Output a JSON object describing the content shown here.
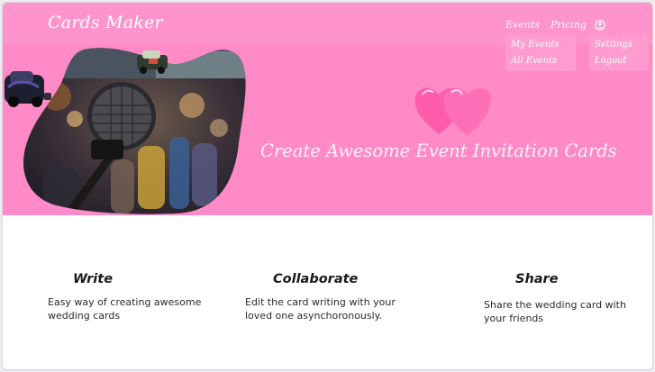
{
  "navbar": {
    "brand": "Cards Maker",
    "events_label": "Events",
    "pricing_label": "Pricing",
    "events_menu": [
      "My Events",
      "All Events"
    ],
    "account_menu": [
      "Settings",
      "Logout"
    ]
  },
  "hero": {
    "tagline": "Create Awesome Event Invitation Cards"
  },
  "features": [
    {
      "title": "Write",
      "description": "Easy way of creating awesome wedding cards"
    },
    {
      "title": "Collaborate",
      "description": "Edit the card writing with your loved one asynchoronously."
    },
    {
      "title": "Share",
      "description": "Share the wedding card with your friends"
    }
  ],
  "colors": {
    "hero_background": "#ff8ac7",
    "navbar_background": "#ff93cb",
    "heart": "#ff5fae",
    "text_light": "#ffffff"
  }
}
